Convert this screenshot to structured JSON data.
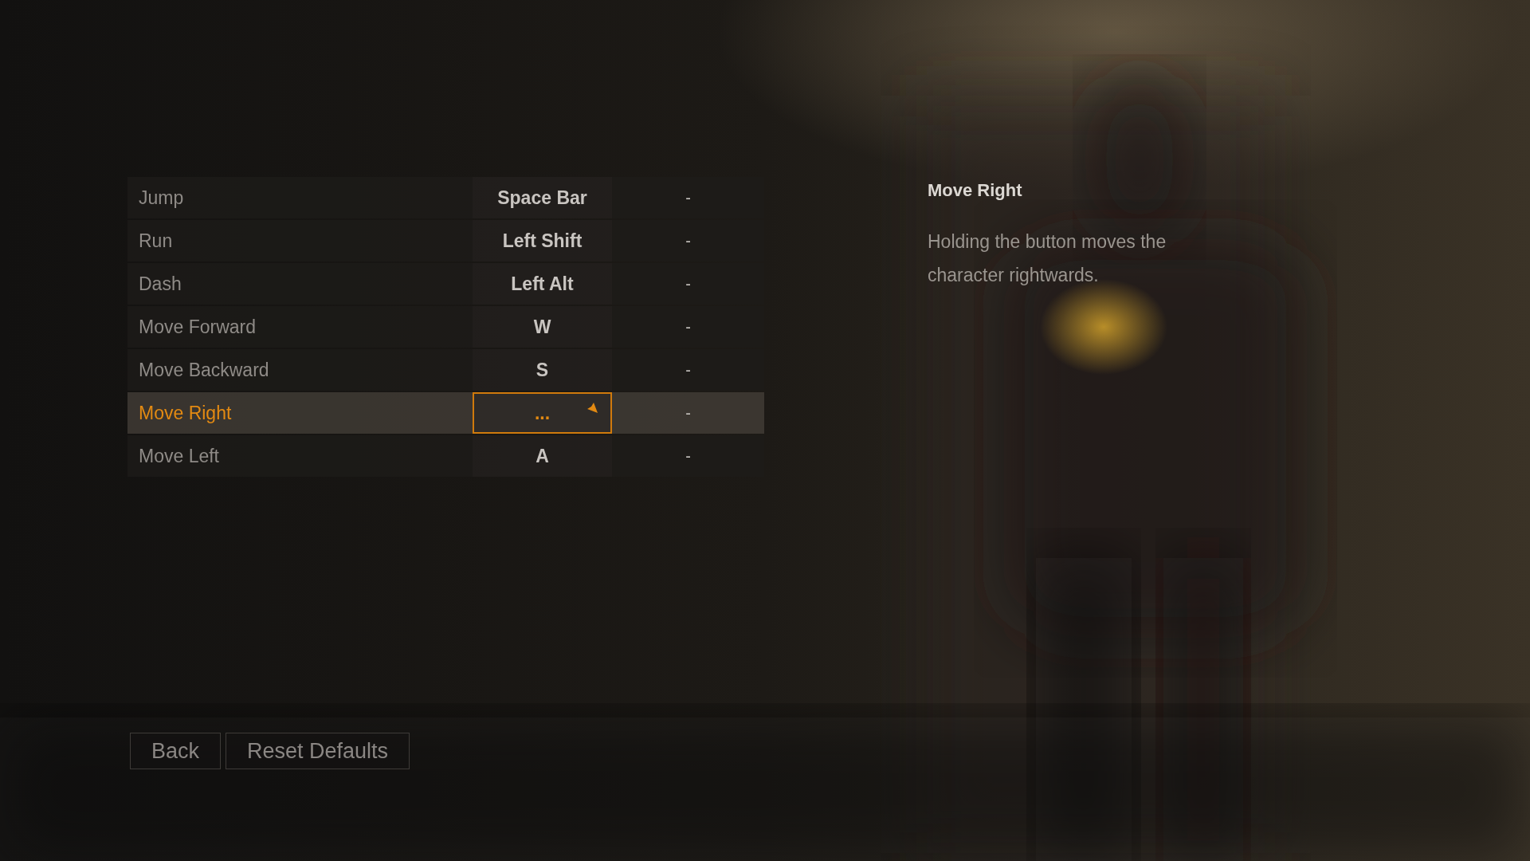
{
  "bindings": [
    {
      "action": "Jump",
      "primary": "Space Bar",
      "secondary": "-",
      "selected": false,
      "listening": false
    },
    {
      "action": "Run",
      "primary": "Left Shift",
      "secondary": "-",
      "selected": false,
      "listening": false
    },
    {
      "action": "Dash",
      "primary": "Left Alt",
      "secondary": "-",
      "selected": false,
      "listening": false
    },
    {
      "action": "Move Forward",
      "primary": "W",
      "secondary": "-",
      "selected": false,
      "listening": false
    },
    {
      "action": "Move Backward",
      "primary": "S",
      "secondary": "-",
      "selected": false,
      "listening": false
    },
    {
      "action": "Move Right",
      "primary": "...",
      "secondary": "-",
      "selected": true,
      "listening": true
    },
    {
      "action": "Move Left",
      "primary": "A",
      "secondary": "-",
      "selected": false,
      "listening": false
    }
  ],
  "detail": {
    "title": "Move Right",
    "description": "Holding the button moves the character rightwards."
  },
  "buttons": [
    "Back",
    "Reset Defaults"
  ]
}
